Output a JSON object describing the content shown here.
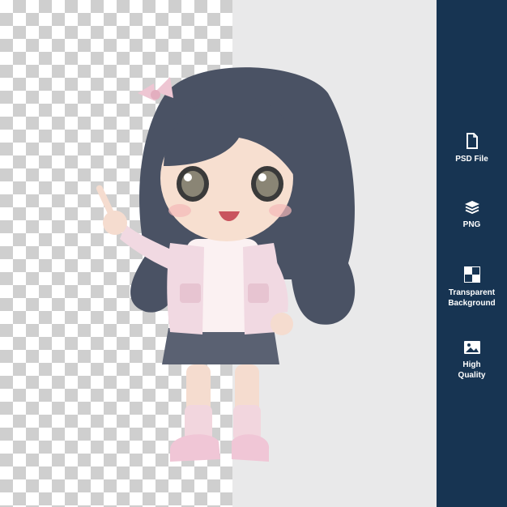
{
  "sidebar": {
    "features": [
      {
        "icon": "file-icon",
        "label": "PSD File"
      },
      {
        "icon": "layers-icon",
        "label": "PNG"
      },
      {
        "icon": "checker-icon",
        "label": "Transparent\nBackground"
      },
      {
        "icon": "image-icon",
        "label": "High\nQuality"
      }
    ]
  },
  "colors": {
    "sidebar_bg": "#173452",
    "plain_bg": "#e9e9ea",
    "checker_dark": "#cfcfcf",
    "hair": "#4a5264",
    "jacket": "#f1d9e2",
    "skirt": "#5a6172"
  }
}
